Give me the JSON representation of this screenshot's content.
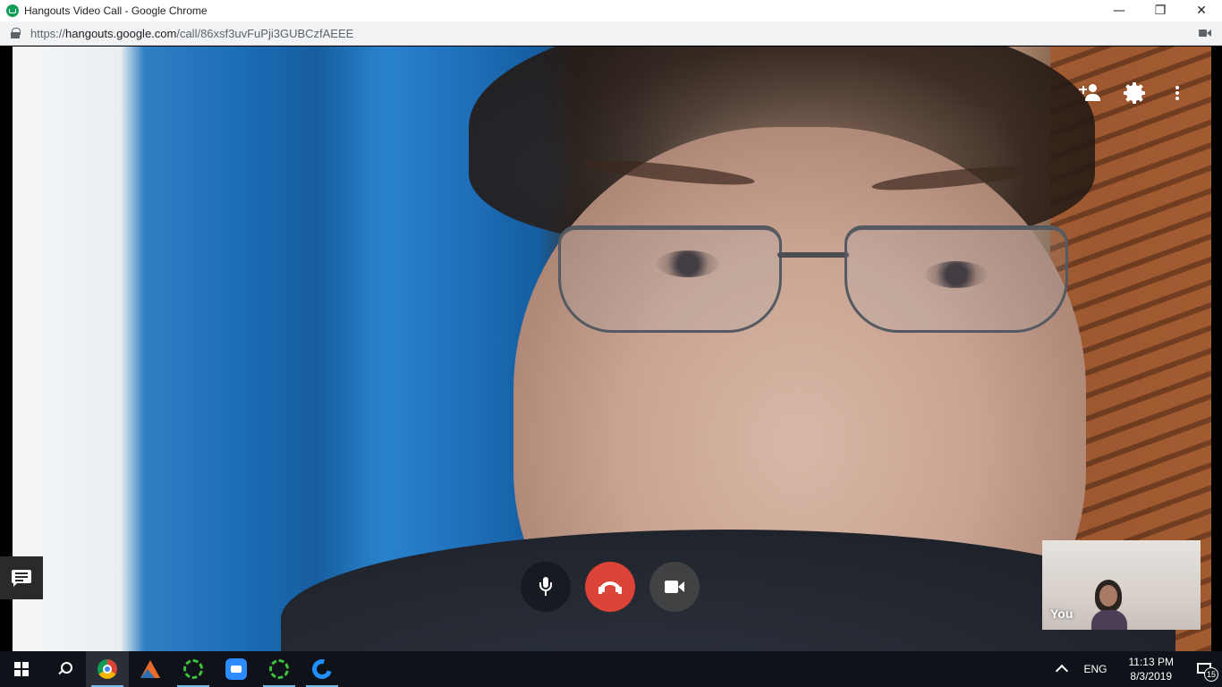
{
  "window": {
    "title": "Hangouts Video Call - Google Chrome",
    "app_icon": "hangouts-icon",
    "controls": {
      "minimize": "—",
      "restore": "❐",
      "close": "✕"
    }
  },
  "address": {
    "scheme": "https://",
    "host": "hangouts.google.com",
    "path": "/call/86xsf3uvFuPji3GUBCzfAEEE"
  },
  "call": {
    "top_controls": [
      "add-person-icon",
      "gear-icon",
      "more-vert-icon"
    ],
    "bottom_controls": [
      "mic-icon",
      "hang-up-icon",
      "video-camera-icon"
    ],
    "hangup_color": "#db4437",
    "self_view": {
      "label": "You"
    },
    "chat_button": "chat-icon"
  },
  "taskbar": {
    "apps": [
      "windows-start-icon",
      "search-icon",
      "chrome-icon",
      "matlab-icon",
      "app-ring-icon",
      "zoom-icon",
      "app-ring-icon",
      "edge-icon"
    ],
    "language": "ENG",
    "time": "11:13 PM",
    "date": "8/3/2019",
    "notification_count": "15"
  }
}
